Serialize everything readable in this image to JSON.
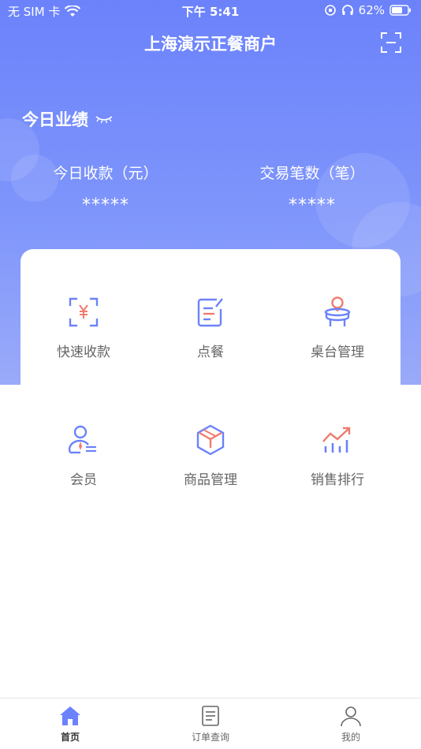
{
  "status_bar": {
    "carrier": "无 SIM 卡",
    "time": "下午 5:41",
    "battery": "62%"
  },
  "header": {
    "title": "上海演示正餐商户"
  },
  "performance": {
    "title": "今日业绩",
    "stats": [
      {
        "label": "今日收款（元）",
        "value": "*****"
      },
      {
        "label": "交易笔数（笔）",
        "value": "*****"
      }
    ]
  },
  "menu": {
    "items": [
      {
        "label": "快速收款",
        "icon": "quick-pay-icon"
      },
      {
        "label": "点餐",
        "icon": "order-food-icon"
      },
      {
        "label": "桌台管理",
        "icon": "table-management-icon"
      },
      {
        "label": "会员",
        "icon": "member-icon"
      },
      {
        "label": "商品管理",
        "icon": "product-box-icon"
      },
      {
        "label": "销售排行",
        "icon": "sales-ranking-icon"
      }
    ]
  },
  "tabbar": {
    "tabs": [
      {
        "label": "首页",
        "icon": "home-icon",
        "active": true
      },
      {
        "label": "订单查询",
        "icon": "order-list-icon",
        "active": false
      },
      {
        "label": "我的",
        "icon": "profile-icon",
        "active": false
      }
    ]
  },
  "colors": {
    "primary": "#6b82fb",
    "accent": "#f07b6e"
  }
}
